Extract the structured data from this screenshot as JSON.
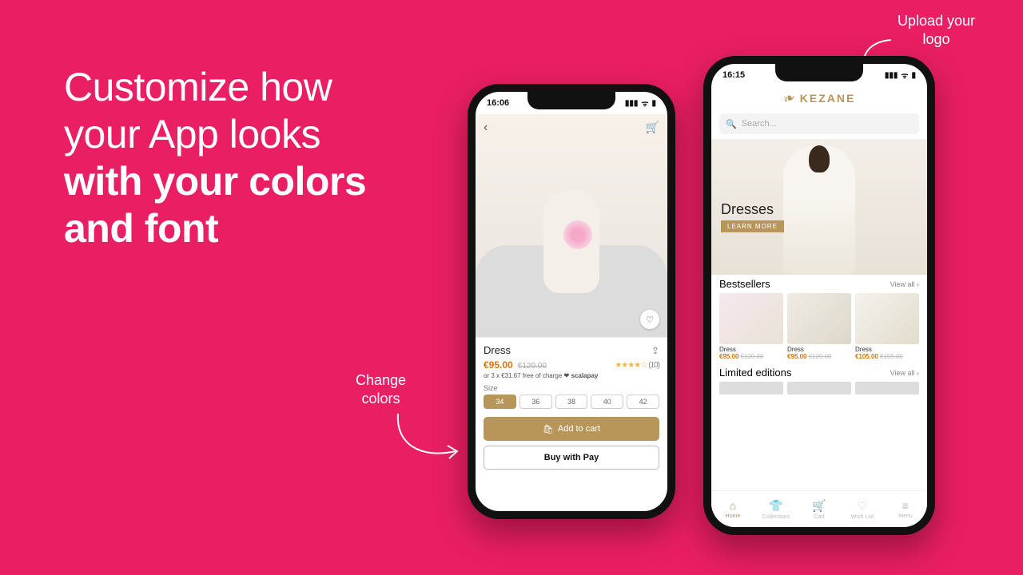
{
  "colors": {
    "bg": "#e91e63",
    "accent": "#b8965a",
    "star": "#f4b740",
    "price": "#d97706"
  },
  "headline": {
    "line1": "Customize how",
    "line2": "your App looks",
    "line3": "with your colors",
    "line4": "and font"
  },
  "annotations": {
    "upload": "Upload your\nlogo",
    "change": "Change\ncolors"
  },
  "phone1": {
    "time": "16:06",
    "product": {
      "title": "Dress",
      "price": "€95.00",
      "old_price": "€120.00",
      "rating_stars": 4,
      "rating_count": "(10)",
      "financing": "or 3 x €31.67 free of charge",
      "financing_brand": "scalapay",
      "size_label": "Size",
      "sizes": [
        "34",
        "36",
        "38",
        "40",
        "42"
      ],
      "size_selected": "34"
    },
    "buttons": {
      "add_to_cart": "Add to cart",
      "buy_with": "Buy with  Pay"
    },
    "icons": {
      "back": "‹",
      "cart": "🛒",
      "share": "⇪",
      "heart": "♡",
      "bag": "🛍"
    }
  },
  "phone2": {
    "time": "16:15",
    "brand": "KEZANE",
    "search_placeholder": "Search...",
    "hero": {
      "title": "Dresses",
      "cta": "LEARN MORE"
    },
    "bestsellers": {
      "title": "Bestsellers",
      "view_all": "View all",
      "items": [
        {
          "name": "Dress",
          "price": "€95.00",
          "old": "€120.00"
        },
        {
          "name": "Dress",
          "price": "€95.00",
          "old": "€120.00"
        },
        {
          "name": "Dress",
          "price": "€105.00",
          "old": "€155.00"
        }
      ]
    },
    "limited": {
      "title": "Limited editions",
      "view_all": "View all"
    },
    "tabs": [
      {
        "icon": "⌂",
        "label": "Home",
        "active": true
      },
      {
        "icon": "👕",
        "label": "Collections",
        "active": false
      },
      {
        "icon": "🛒",
        "label": "Cart",
        "active": false
      },
      {
        "icon": "♡",
        "label": "Wish List",
        "active": false
      },
      {
        "icon": "≡",
        "label": "Menu",
        "active": false
      }
    ]
  }
}
